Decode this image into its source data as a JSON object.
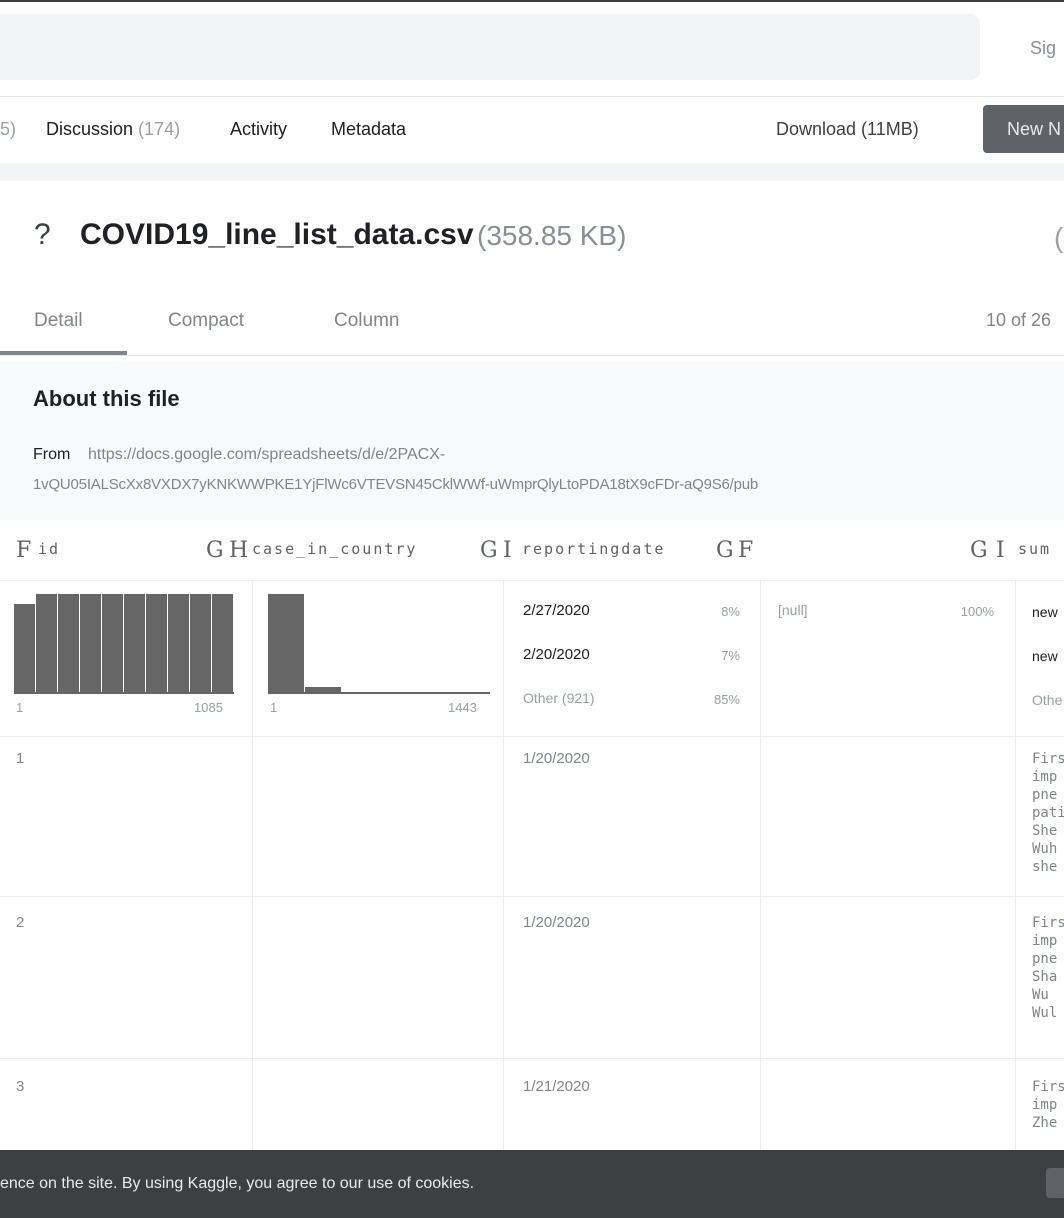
{
  "header": {
    "signin": "Sig"
  },
  "tabs": {
    "cut_count": "5)",
    "discussion_label": "Discussion",
    "discussion_count": "(174)",
    "activity_label": "Activity",
    "metadata_label": "Metadata",
    "download_label": "Download (11MB)",
    "new_button": "New N"
  },
  "file": {
    "icon": "?",
    "name": "COVID19_line_list_data.csv",
    "size": "(358.85 KB)",
    "right_paren": "("
  },
  "view_tabs": [
    "Detail",
    "Compact",
    "Column"
  ],
  "active_view_tab": "Detail",
  "page_count": "10 of 26",
  "about": {
    "title": "About this file",
    "from_label": "From",
    "url_line1": "https://docs.google.com/spreadsheets/d/e/2PACX-",
    "url_line2": "1vQU05IALScXx8VXDX7yKNKWWPKE1YjFlWc6VTEVSN45CklWWf-uWmprQlyLtoPDA18tX9cFDr-aQ9S6/pub"
  },
  "table": {
    "header_glyphs": {
      "g1": "F",
      "g2": "G",
      "g3": "H",
      "g4": "G",
      "g5": "I",
      "g6": "G",
      "g7": "F",
      "g8": "G",
      "g9": "I"
    },
    "columns": [
      "id",
      "case_in_country",
      "reportingdate",
      "",
      "sum"
    ],
    "id_range": {
      "min": "1",
      "max": "1085"
    },
    "case_range": {
      "min": "1",
      "max": "1443"
    },
    "id_hist": [
      0.9,
      1,
      1,
      1,
      1,
      1,
      1,
      1,
      1,
      1
    ],
    "case_hist": [
      1,
      0.07,
      0.02,
      0.02,
      0.02,
      0.02
    ],
    "reporting_stats": [
      {
        "value": "2/27/2020",
        "pct": "8%"
      },
      {
        "value": "2/20/2020",
        "pct": "7%"
      },
      {
        "value": "Other (921)",
        "pct": "85%"
      }
    ],
    "col4_stats": [
      {
        "value": "[null]",
        "pct": "100%"
      }
    ],
    "sum_stats": [
      "new",
      "new",
      "Othe"
    ],
    "rows": [
      {
        "id": "1",
        "date": "1/20/2020",
        "summary": "Firs\nimp\npne\npati\nShe\nWuh\nshe"
      },
      {
        "id": "2",
        "date": "1/20/2020",
        "summary": "Firs\nimp\npne\nSha\nWu\nWul"
      },
      {
        "id": "3",
        "date": "1/21/2020",
        "summary": "Firs\nimp\nZhe"
      }
    ]
  },
  "cookie": {
    "text": "ence on the site. By using Kaggle, you agree to our use of cookies."
  },
  "colors": {
    "bar_fill": "#666666",
    "cookie_bg": "#3c4043",
    "button_bg": "#5f6368"
  }
}
